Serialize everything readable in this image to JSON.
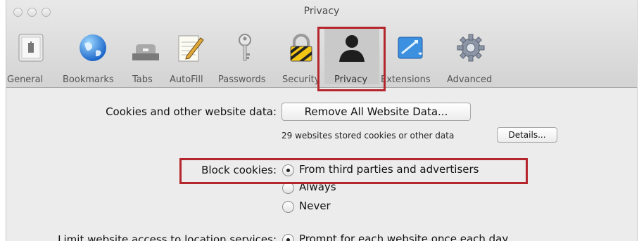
{
  "window": {
    "title": "Privacy"
  },
  "toolbar": [
    {
      "label": "General",
      "icon": "general-icon"
    },
    {
      "label": "Bookmarks",
      "icon": "globe-icon"
    },
    {
      "label": "Tabs",
      "icon": "tabs-icon"
    },
    {
      "label": "AutoFill",
      "icon": "pencil-notepad-icon"
    },
    {
      "label": "Passwords",
      "icon": "key-icon"
    },
    {
      "label": "Security",
      "icon": "lock-icon"
    },
    {
      "label": "Privacy",
      "icon": "person-silhouette-icon",
      "selected": true
    },
    {
      "label": "Extensions",
      "icon": "puzzle-icon"
    },
    {
      "label": "Advanced",
      "icon": "gear-icon"
    }
  ],
  "cookies": {
    "label": "Cookies and other website data:",
    "remove_button": "Remove All Website Data...",
    "stored_note": "29 websites stored cookies or other data",
    "details_button": "Details..."
  },
  "block_cookies": {
    "label": "Block cookies:",
    "options": [
      {
        "label": "From third parties and advertisers",
        "selected": true
      },
      {
        "label": "Always",
        "selected": false
      },
      {
        "label": "Never",
        "selected": false
      }
    ]
  },
  "location": {
    "label": "Limit website access to location services:",
    "option": "Prompt for each website once each day"
  },
  "colors": {
    "highlight": "#b5262c"
  }
}
